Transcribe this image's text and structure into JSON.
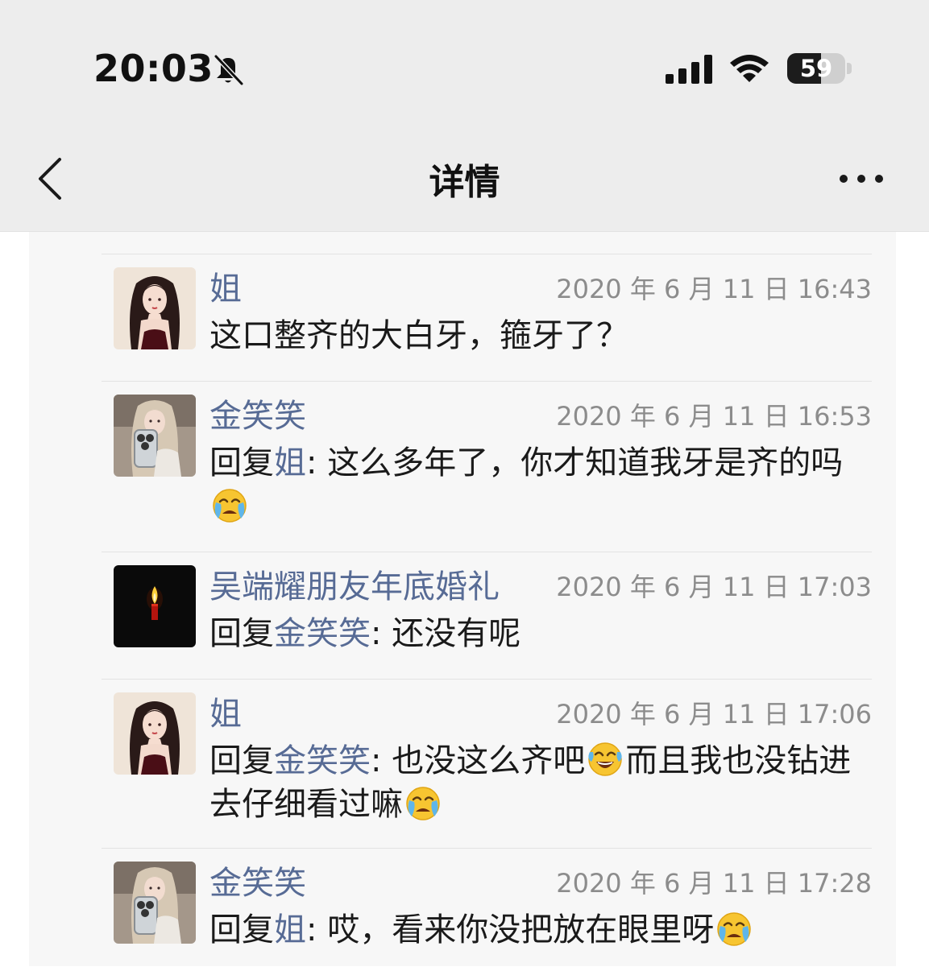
{
  "status_bar": {
    "time": "20:03",
    "battery_percent": "59",
    "battery_level": 0.59
  },
  "nav": {
    "title": "详情"
  },
  "comments": [
    {
      "author": "姐",
      "timestamp": "2020 年 6 月 11 日 16:43",
      "text": "这口整齐的大白牙，箍牙了？"
    },
    {
      "author": "金笑笑",
      "timestamp": "2020 年 6 月 11 日 16:53",
      "reply_prefix": "回复",
      "reply_to": "姐",
      "colon": ": ",
      "text": "这么多年了，你才知道我牙是齐的吗",
      "emoji": "loudly-crying-face"
    },
    {
      "author": "吴端耀朋友年底婚礼",
      "timestamp": "2020 年 6 月 11 日 17:03",
      "reply_prefix": "回复",
      "reply_to": "金笑笑",
      "colon": ": ",
      "text": "还没有呢"
    },
    {
      "author": "姐",
      "timestamp": "2020 年 6 月 11 日 17:06",
      "reply_prefix": "回复",
      "reply_to": "金笑笑",
      "colon": ": ",
      "text_part1": "也没这么齐吧",
      "emoji_1": "face-with-tears-of-joy",
      "text_part2": "而且我也没钻进去仔细看过嘛",
      "emoji_2": "loudly-crying-face"
    },
    {
      "author": "金笑笑",
      "timestamp": "2020 年 6 月 11 日 17:28",
      "reply_prefix": "回复",
      "reply_to": "姐",
      "colon": ": ",
      "text": "哎，看来你没把放在眼里呀",
      "emoji": "loudly-crying-face"
    }
  ],
  "colors": {
    "link_blue": "#576b95",
    "timestamp_gray": "#8c8c8c",
    "header_bg": "#ededed",
    "panel_bg": "#f7f7f7"
  }
}
